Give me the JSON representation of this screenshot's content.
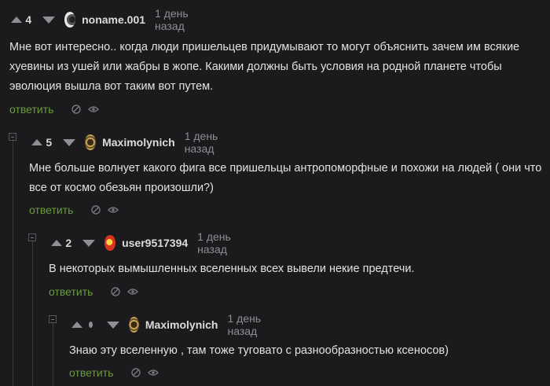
{
  "comments": [
    {
      "score": "4",
      "username": "noname.001",
      "time": "1 день назад",
      "text": "Мне вот интересно.. когда люди пришельцев придумывают то могут объяснить зачем им всякие хуевины из ушей или жабры в жопе. Какими должны быть условия на родной планете чтобы эволюция вышла вот таким вот путем.",
      "reply_label": "ответить",
      "avatar": "ring-avatar"
    },
    {
      "score": "5",
      "username": "Maximolynich",
      "time": "1 день назад",
      "text": "Мне больше волнует какого фига все пришельцы антропоморфные и похожи на людей ( они что все от космо обезьян произошли?)",
      "reply_label": "ответить",
      "avatar": "gear-avatar"
    },
    {
      "score": "2",
      "username": "user9517394",
      "time": "1 день назад",
      "text": "В некоторых вымышленных вселенных всех вывели некие предтечи.",
      "reply_label": "ответить",
      "avatar": "red-emblem-avatar"
    },
    {
      "score": "",
      "username": "Maximolynich",
      "time": "1 день назад",
      "text": "Знаю эту вселенную , там тоже туговато с разнообразностью ксеносов)",
      "reply_label": "ответить",
      "avatar": "gear-avatar"
    }
  ],
  "icons": {
    "vote_up": "triangle-up-icon",
    "vote_down": "triangle-down-icon",
    "hide": "slashed-circle-icon",
    "view": "eye-icon",
    "collapse": "collapse-minus-icon"
  },
  "colors": {
    "background": "#1b1b1d",
    "reply_link": "#6a9b3d",
    "muted": "#8e8e93",
    "text": "#e2e2e2"
  }
}
